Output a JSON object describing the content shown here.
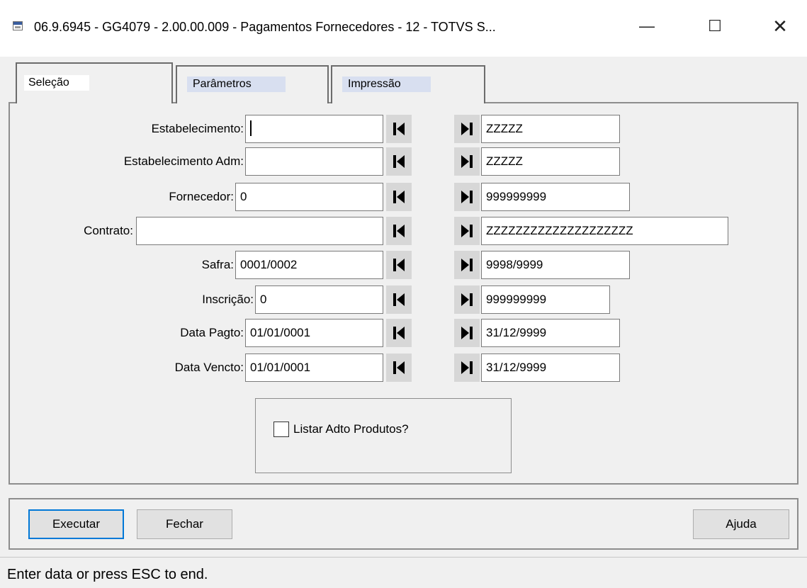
{
  "window": {
    "title": "06.9.6945 - GG4079 - 2.00.00.009 - Pagamentos Fornecedores - 12 - TOTVS S...",
    "controls": {
      "minimize": "—",
      "maximize": "☐",
      "close": "✕"
    }
  },
  "tabs": [
    {
      "label": "Seleção",
      "active": true
    },
    {
      "label": "Parâmetros",
      "active": false
    },
    {
      "label": "Impressão",
      "active": false
    }
  ],
  "form": {
    "rows": [
      {
        "label": "Estabelecimento:",
        "from": "",
        "to": "ZZZZZ"
      },
      {
        "label": "Estabelecimento Adm:",
        "from": "",
        "to": "ZZZZZ"
      },
      {
        "label": "Fornecedor:",
        "from": "0",
        "to": "999999999"
      },
      {
        "label": "Contrato:",
        "from": "",
        "to": "ZZZZZZZZZZZZZZZZZZZZ"
      },
      {
        "label": "Safra:",
        "from": "0001/0002",
        "to": "9998/9999"
      },
      {
        "label": "Inscrição:",
        "from": "0",
        "to": "999999999"
      },
      {
        "label": "Data Pagto:",
        "from": "01/01/0001",
        "to": "31/12/9999"
      },
      {
        "label": "Data Vencto:",
        "from": "01/01/0001",
        "to": "31/12/9999"
      }
    ],
    "checkbox": {
      "label": "Listar Adto Produtos?",
      "checked": false
    }
  },
  "buttons": {
    "executar": "Executar",
    "fechar": "Fechar",
    "ajuda": "Ajuda"
  },
  "status": "Enter data or press ESC to end."
}
